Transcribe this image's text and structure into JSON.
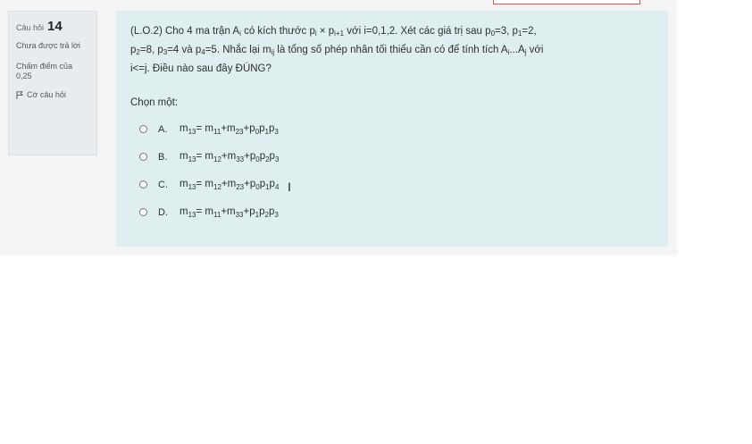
{
  "question": {
    "number_label": "Câu hỏi",
    "number": "14",
    "state": "Chưa được trả lời",
    "grade": "Chấm điểm của 0,25",
    "flag_label": "Cờ câu hỏi",
    "text": {
      "t1": "(L.O.2) Cho 4 ma trận A",
      "s1": "i",
      "t2": " có kích thước p",
      "s2": "i",
      "t3": " × p",
      "s3": "i+1",
      "t4": " với i=0,1,2. Xét các giá trị sau p",
      "s4": "0",
      "t5": "=3, p",
      "s5": "1",
      "t6": "=2,",
      "t7": "p",
      "s7": "2",
      "t8": "=8, p",
      "s8": "3",
      "t9": "=4 và p",
      "s9": "4",
      "t10": "=5. Nhắc lại m",
      "s10": "ij",
      "t11": " là tổng số phép nhân tối thiểu cần có để tính tích A",
      "s11": "i",
      "t12": "...A",
      "s12": "j",
      "t13": " với",
      "t14": "i<=j. Điều nào sau đây ĐÚNG?"
    },
    "prompt": "Chọn một:",
    "answers": [
      {
        "letter": "A.",
        "f": [
          "m",
          "13",
          "= m",
          "11",
          "+m",
          "23",
          "+p",
          "0",
          "p",
          "1",
          "p",
          "3"
        ]
      },
      {
        "letter": "B.",
        "f": [
          "m",
          "13",
          "= m",
          "12",
          "+m",
          "33",
          "+p",
          "0",
          "p",
          "2",
          "p",
          "3"
        ]
      },
      {
        "letter": "C.",
        "f": [
          "m",
          "13",
          "= m",
          "12",
          "+m",
          "23",
          "+p",
          "0",
          "p",
          "1",
          "p",
          "4"
        ]
      },
      {
        "letter": "D.",
        "f": [
          "m",
          "13",
          "= m",
          "11",
          "+m",
          "33",
          "+p",
          "1",
          "p",
          "2",
          "p",
          "3"
        ]
      }
    ]
  },
  "colors": {
    "content_bg": "#dfeeee",
    "info_bg": "#e9ecef",
    "accent_border": "#d9534f"
  },
  "icons": {
    "flag": "flag-icon",
    "radio": "radio-icon",
    "cursor": "text-cursor-icon"
  }
}
